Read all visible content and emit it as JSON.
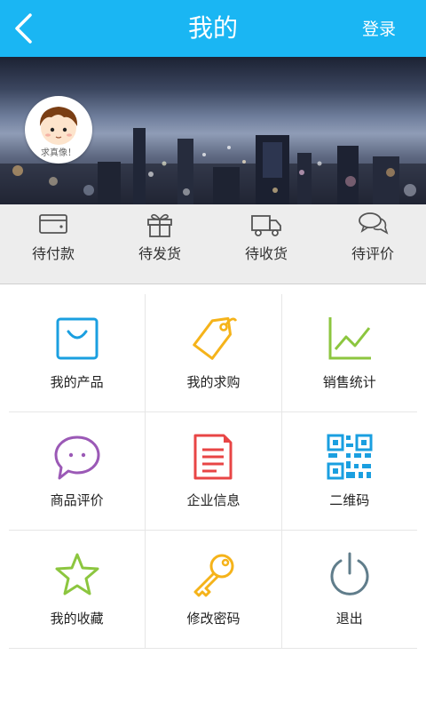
{
  "header": {
    "title": "我的",
    "login_label": "登录",
    "background": "#1ab6f3"
  },
  "profile": {
    "avatar_label": "求真像！"
  },
  "orders": [
    {
      "label": "待付款",
      "icon": "wallet-icon"
    },
    {
      "label": "待发货",
      "icon": "gift-box-icon"
    },
    {
      "label": "待收货",
      "icon": "delivery-truck-icon"
    },
    {
      "label": "待评价",
      "icon": "chat-bubbles-icon"
    }
  ],
  "menu": [
    {
      "label": "我的产品",
      "icon": "shopping-bag-icon",
      "color": "#1a9fe0"
    },
    {
      "label": "我的求购",
      "icon": "price-tag-icon",
      "color": "#f5b31a"
    },
    {
      "label": "销售统计",
      "icon": "line-chart-icon",
      "color": "#8cc63f"
    },
    {
      "label": "商品评价",
      "icon": "chat-bubble-icon",
      "color": "#9b59b6"
    },
    {
      "label": "企业信息",
      "icon": "document-icon",
      "color": "#e84545"
    },
    {
      "label": "二维码",
      "icon": "qr-code-icon",
      "color": "#1a9fe0"
    },
    {
      "label": "我的收藏",
      "icon": "star-icon",
      "color": "#8cc63f"
    },
    {
      "label": "修改密码",
      "icon": "key-icon",
      "color": "#f5b31a"
    },
    {
      "label": "退出",
      "icon": "power-icon",
      "color": "#607d8b"
    }
  ]
}
